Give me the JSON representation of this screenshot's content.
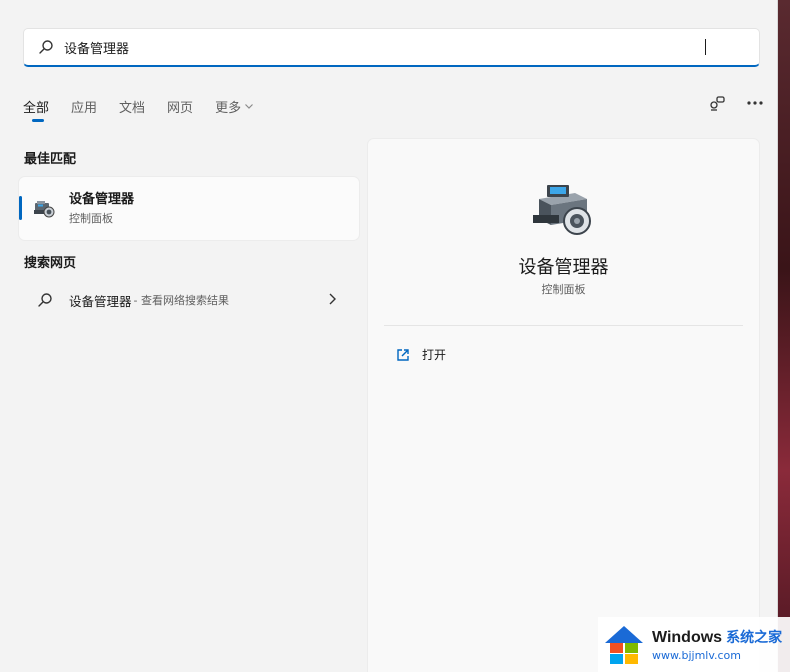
{
  "search": {
    "value": "设备管理器",
    "placeholder": ""
  },
  "tabs": [
    {
      "label": "全部",
      "active": true
    },
    {
      "label": "应用",
      "active": false
    },
    {
      "label": "文档",
      "active": false
    },
    {
      "label": "网页",
      "active": false
    },
    {
      "label": "更多",
      "active": false
    }
  ],
  "left": {
    "best_match_title": "最佳匹配",
    "best_match": {
      "title": "设备管理器",
      "subtitle": "控制面板"
    },
    "web_title": "搜索网页",
    "web_result": {
      "title": "设备管理器",
      "suffix": " - 查看网络搜索结果"
    }
  },
  "detail": {
    "title": "设备管理器",
    "subtitle": "控制面板",
    "open_label": "打开"
  },
  "watermark": {
    "brand": "Windows",
    "brand_zh": "系统之家",
    "url": "www.bjjmlv.com"
  },
  "colors": {
    "accent": "#0067c0",
    "panel_bg": "#f3f3f3"
  }
}
